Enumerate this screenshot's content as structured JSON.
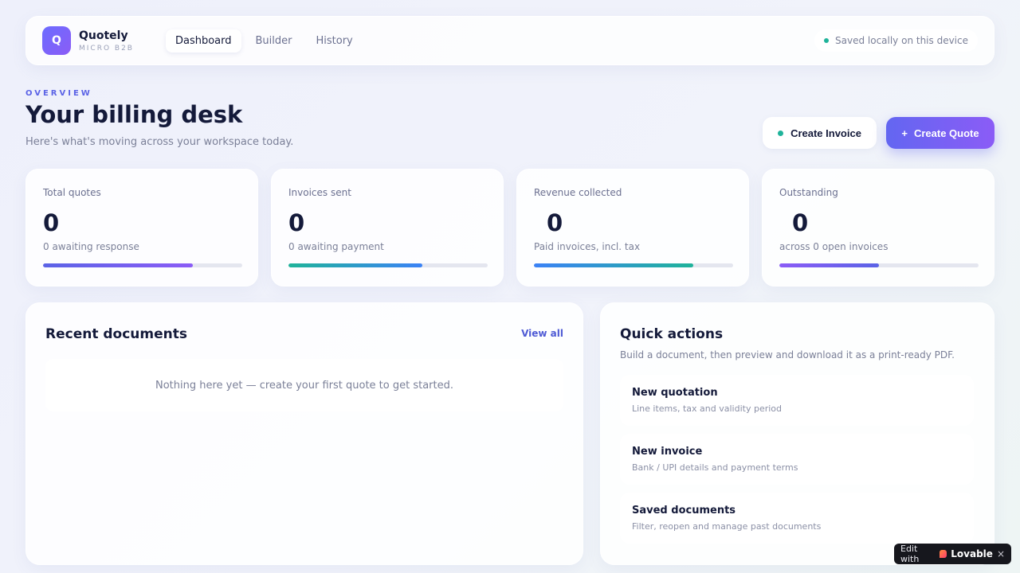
{
  "header": {
    "logo_letter": "Q",
    "brand_name": "Quotely",
    "brand_sub": "MICRO B2B",
    "nav": [
      {
        "label": "Dashboard",
        "active": true
      },
      {
        "label": "Builder",
        "active": false
      },
      {
        "label": "History",
        "active": false
      }
    ],
    "status": "Saved locally on this device"
  },
  "page": {
    "overline": "OVERVIEW",
    "title": "Your billing desk",
    "subtitle": "Here's what's moving across your workspace today."
  },
  "actions": {
    "create_invoice": "Create Invoice",
    "create_quote_icon": "+",
    "create_quote": "Create Quote"
  },
  "stats": [
    {
      "label": "Total quotes",
      "value": "0",
      "note": "0 awaiting response",
      "progress": 0.75,
      "color_from": "#5b63e6",
      "color_to": "#8b5cf6"
    },
    {
      "label": "Invoices sent",
      "value": "0",
      "note": "0 awaiting payment",
      "progress": 0.67,
      "color_from": "#1fb39a",
      "color_to": "#3b82f6"
    },
    {
      "label": "Revenue collected",
      "value": "0",
      "note": "Paid invoices, incl. tax",
      "progress": 0.8,
      "color_from": "#3b82f6",
      "color_to": "#1fb39a"
    },
    {
      "label": "Outstanding",
      "value": "0",
      "note": "across 0 open invoices",
      "progress": 0.5,
      "color_from": "#8b5cf6",
      "color_to": "#5b63e6"
    }
  ],
  "recent": {
    "title": "Recent documents",
    "view_all": "View all",
    "empty": "Nothing here yet — create your first quote to get started."
  },
  "quick_actions": {
    "title": "Quick actions",
    "subtitle": "Build a document, then preview and download it as a print-ready PDF.",
    "items": [
      {
        "title": "New quotation",
        "desc": "Line items, tax and validity period"
      },
      {
        "title": "New invoice",
        "desc": "Bank / UPI details and payment terms"
      },
      {
        "title": "Saved documents",
        "desc": "Filter, reopen and manage past documents"
      }
    ]
  },
  "badge": {
    "prefix": "Edit with",
    "name": "Lovable",
    "close": "×"
  },
  "colors": {
    "accent": "#6366f1",
    "accent2": "#8b5cf6",
    "status_dot": "#1fb39a",
    "text": "#141a3a"
  }
}
